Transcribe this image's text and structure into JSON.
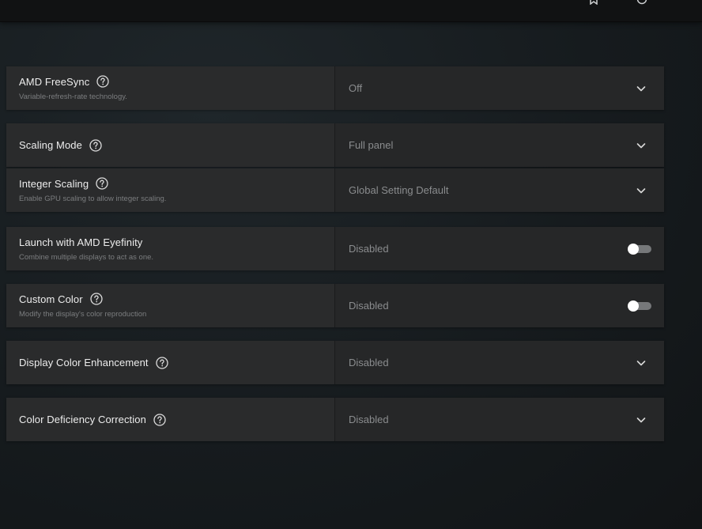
{
  "topbar": {
    "icons": [
      "bookmark-icon",
      "refresh-icon"
    ]
  },
  "settings": {
    "freesync": {
      "title": "AMD FreeSync",
      "subtitle": "Variable-refresh-rate technology.",
      "value": "Off",
      "control": "dropdown"
    },
    "scaling_mode": {
      "title": "Scaling Mode",
      "value": "Full panel",
      "control": "dropdown"
    },
    "integer_scaling": {
      "title": "Integer Scaling",
      "subtitle": "Enable GPU scaling to allow integer scaling.",
      "value": "Global Setting Default",
      "control": "dropdown"
    },
    "eyefinity": {
      "title": "Launch with AMD Eyefinity",
      "subtitle": "Combine multiple displays to act as one.",
      "value": "Disabled",
      "control": "toggle",
      "enabled": false
    },
    "custom_color": {
      "title": "Custom Color",
      "subtitle": "Modify the display's color reproduction",
      "value": "Disabled",
      "control": "toggle",
      "enabled": false
    },
    "color_enhancement": {
      "title": "Display Color Enhancement",
      "value": "Disabled",
      "control": "dropdown"
    },
    "color_deficiency": {
      "title": "Color Deficiency Correction",
      "value": "Disabled",
      "control": "dropdown"
    }
  },
  "colors": {
    "panel_label": "#2a2b2c",
    "panel_value": "#262728",
    "text_primary": "#ededed",
    "text_value": "#8a8c8e",
    "text_sub": "#7b7d7f",
    "toggle_off_track": "#76787a"
  }
}
